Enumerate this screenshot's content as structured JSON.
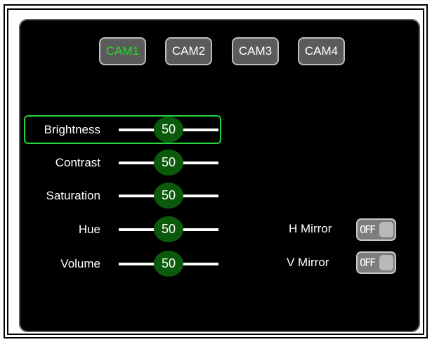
{
  "cameras": [
    {
      "label": "CAM1",
      "active": true
    },
    {
      "label": "CAM2",
      "active": false
    },
    {
      "label": "CAM3",
      "active": false
    },
    {
      "label": "CAM4",
      "active": false
    }
  ],
  "settings": [
    {
      "label": "Brightness",
      "value": "50",
      "selected": true
    },
    {
      "label": "Contrast",
      "value": "50",
      "selected": false
    },
    {
      "label": "Saturation",
      "value": "50",
      "selected": false
    },
    {
      "label": "Hue",
      "value": "50",
      "selected": false
    },
    {
      "label": "Volume",
      "value": "50",
      "selected": false
    }
  ],
  "mirrors": [
    {
      "label": "H Mirror",
      "state": "OFF"
    },
    {
      "label": "V Mirror",
      "state": "OFF"
    }
  ],
  "colors": {
    "active_text": "#22e021",
    "selection_border": "#21d43f",
    "knob": "#0b5a0b",
    "button_bg": "#5b5b5b"
  }
}
